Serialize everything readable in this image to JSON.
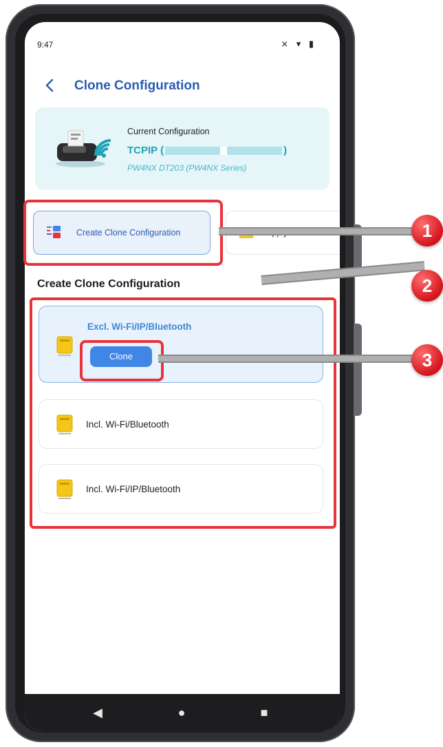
{
  "status": {
    "time": "9:47",
    "icons": "⨯ ▾ ▮"
  },
  "header": {
    "back_icon": "chevron-left-icon",
    "title": "Clone Configuration"
  },
  "current": {
    "label": "Current Configuration",
    "connection_prefix": "TCPIP (",
    "connection_suffix": ")",
    "model": "PW4NX DT203 (PW4NX Series)"
  },
  "tabs": [
    {
      "label": "Create Clone Configuration"
    },
    {
      "label": "Apply Clone Con"
    }
  ],
  "section_title": "Create Clone Configuration",
  "options": [
    {
      "label": "Excl. Wi-Fi/IP/Bluetooth",
      "button": "Clone"
    },
    {
      "label": "Incl. Wi-Fi/Bluetooth"
    },
    {
      "label": "Incl. Wi-Fi/IP/Bluetooth"
    }
  ],
  "nav": {
    "back": "◀",
    "home": "●",
    "recent": "■"
  },
  "annotations": [
    "1",
    "2",
    "3"
  ],
  "colors": {
    "accent": "#2a5db0",
    "highlight": "#e8333b",
    "teal": "#1aa3b8",
    "button": "#3f86e6"
  }
}
